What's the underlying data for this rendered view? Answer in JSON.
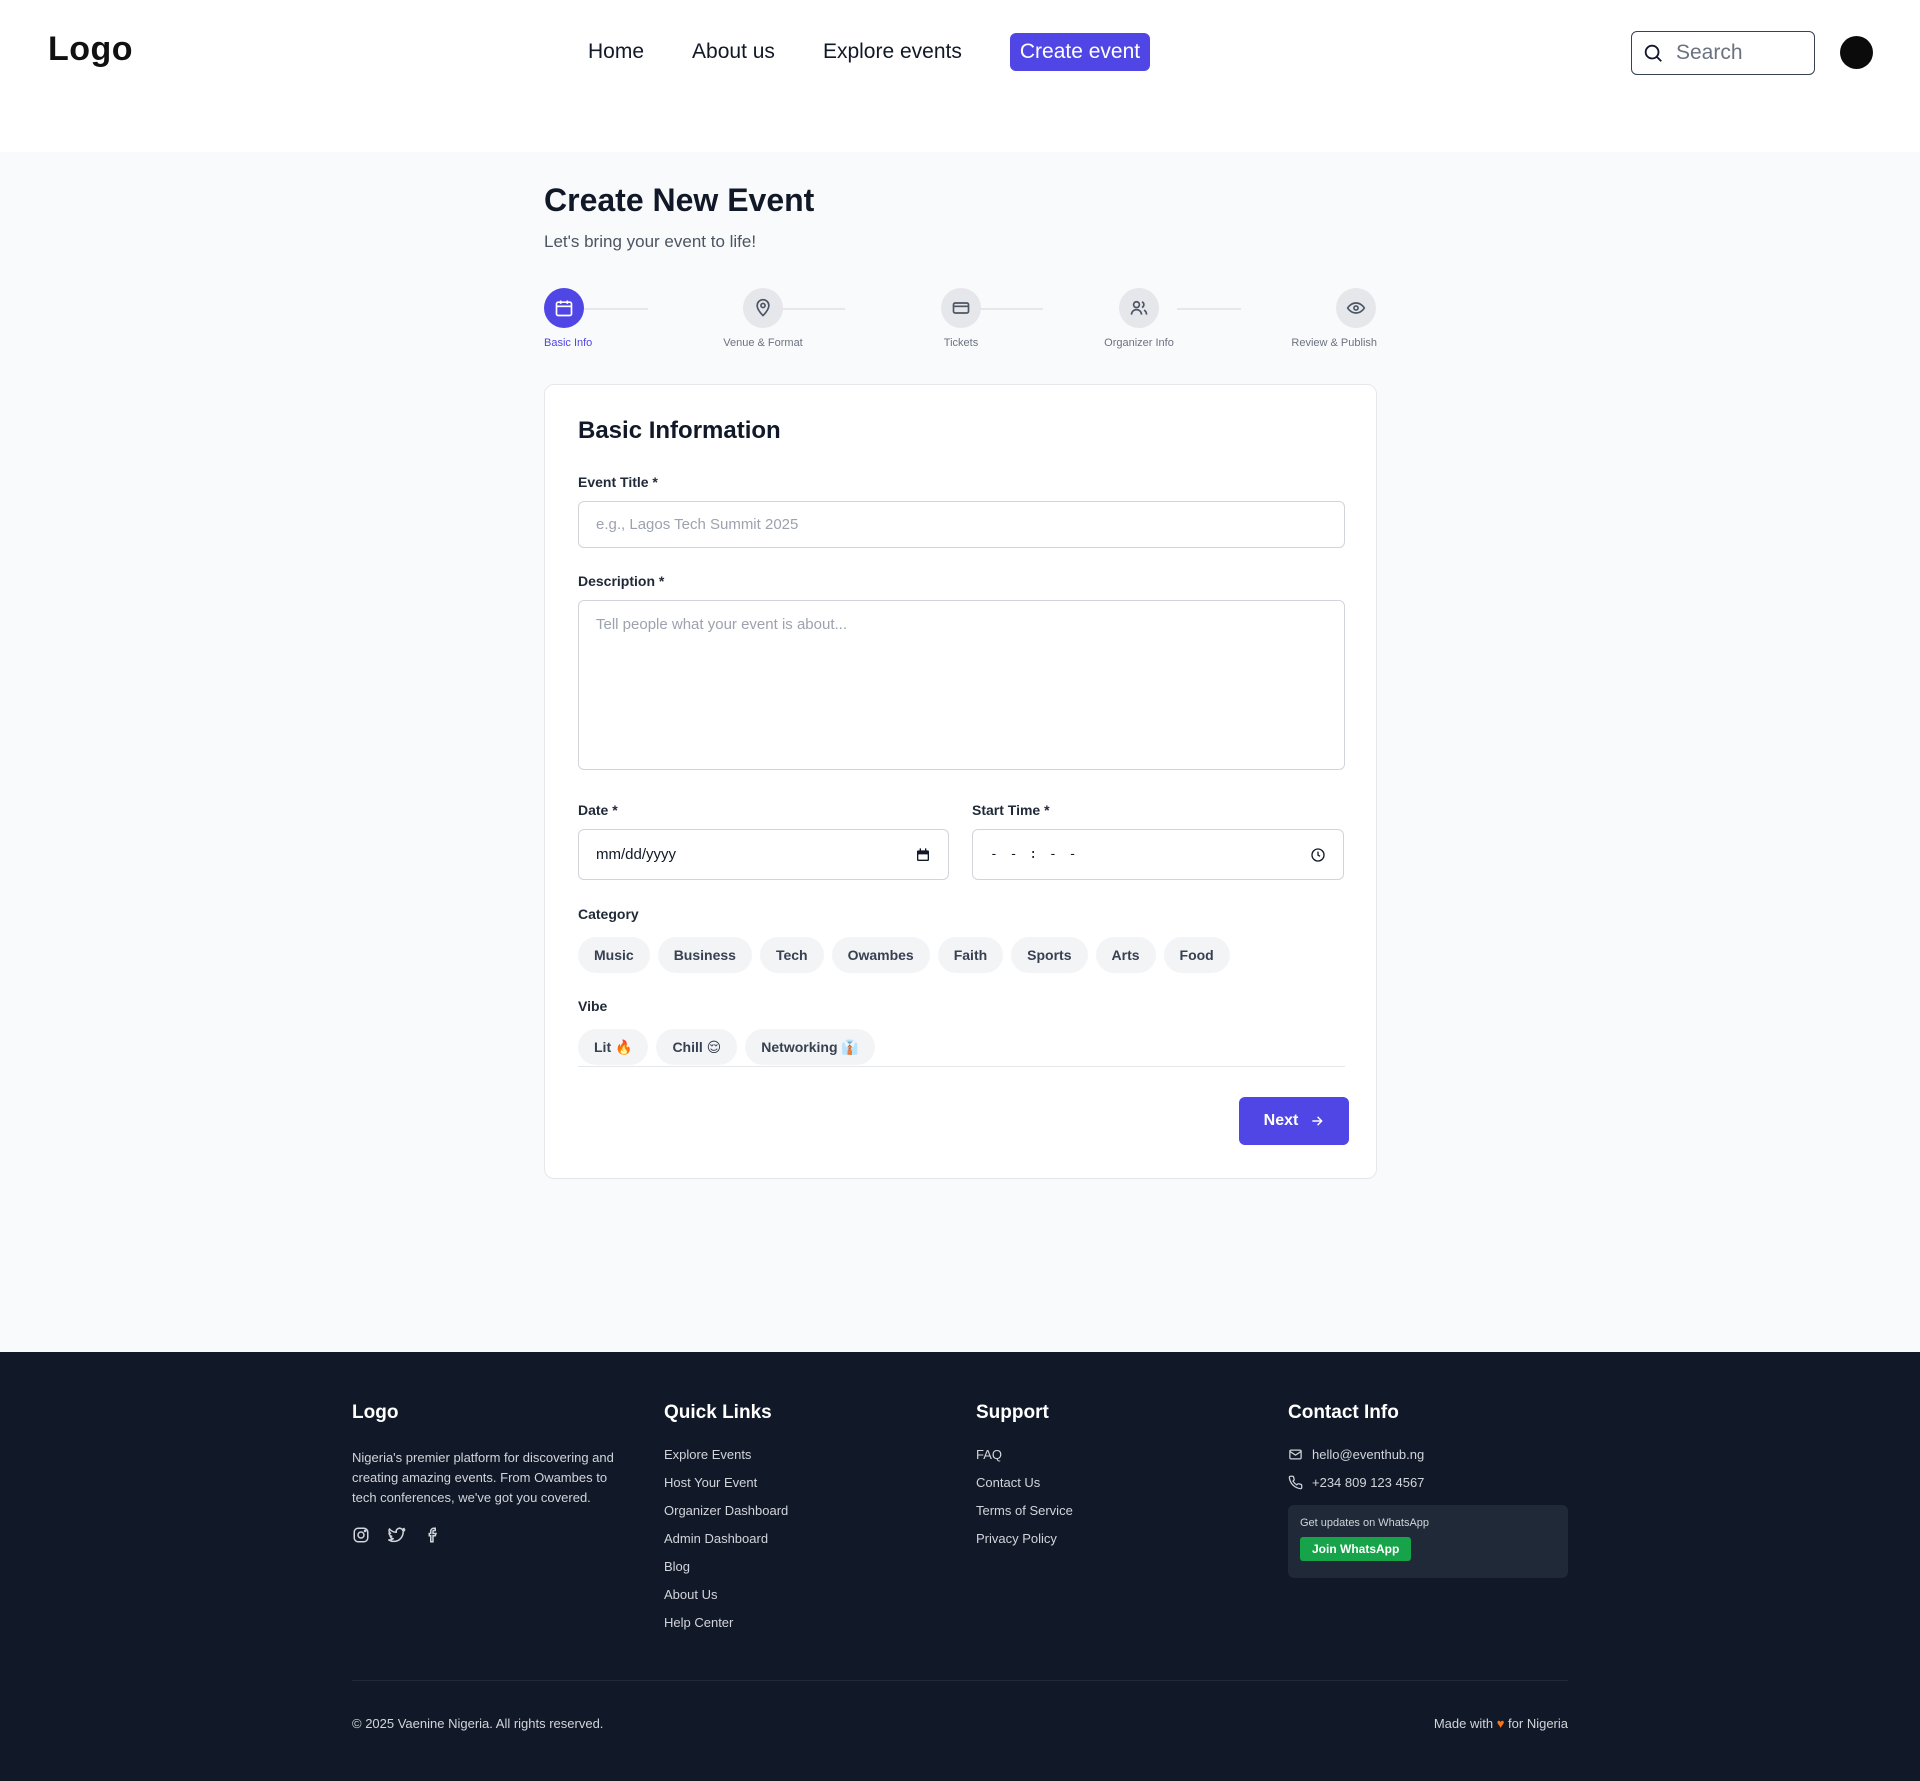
{
  "header": {
    "logo": "Logo",
    "nav": [
      "Home",
      "About us",
      "Explore events"
    ],
    "create_label": "Create event",
    "search_placeholder": "Search"
  },
  "page": {
    "title": "Create New Event",
    "subtitle": "Let's bring your event to life!"
  },
  "steps": [
    {
      "label": "Basic Info",
      "icon": "calendar-icon",
      "active": true
    },
    {
      "label": "Venue & Format",
      "icon": "map-pin-icon",
      "active": false
    },
    {
      "label": "Tickets",
      "icon": "ticket-icon",
      "active": false
    },
    {
      "label": "Organizer Info",
      "icon": "users-icon",
      "active": false
    },
    {
      "label": "Review & Publish",
      "icon": "eye-icon",
      "active": false
    }
  ],
  "form": {
    "title": "Basic Information",
    "event_title_label": "Event Title *",
    "event_title_placeholder": "e.g., Lagos Tech Summit 2025",
    "description_label": "Description *",
    "description_placeholder": "Tell people what your event is about...",
    "date_label": "Date *",
    "date_placeholder": "mm/dd/yyyy",
    "time_label": "Start Time *",
    "time_placeholder": "- - : - -",
    "category_label": "Category",
    "categories": [
      "Music",
      "Business",
      "Tech",
      "Owambes",
      "Faith",
      "Sports",
      "Arts",
      "Food"
    ],
    "vibe_label": "Vibe",
    "vibes": [
      "Lit 🔥",
      "Chill 😌",
      "Networking 👔"
    ],
    "next_label": "Next"
  },
  "footer": {
    "logo": "Logo",
    "description": "Nigeria's premier platform for discovering and creating amazing events. From Owambes to tech conferences, we've got you covered.",
    "quick_links_title": "Quick Links",
    "quick_links": [
      "Explore Events",
      "Host Your Event",
      "Organizer Dashboard",
      "Admin Dashboard",
      "Blog",
      "About Us",
      "Help Center"
    ],
    "support_title": "Support",
    "support_links": [
      "FAQ",
      "Contact Us",
      "Terms of Service",
      "Privacy Policy"
    ],
    "contact_title": "Contact Info",
    "email": "hello@eventhub.ng",
    "phone": "+234 809 123 4567",
    "whatsapp_text": "Get updates on WhatsApp",
    "whatsapp_button": "Join WhatsApp",
    "copyright": "© 2025 Vaenine Nigeria. All rights reserved.",
    "made_with_prefix": "Made with",
    "made_with_suffix": "for Nigeria"
  },
  "colors": {
    "accent": "#4f46e5",
    "footer_bg": "#111827",
    "whatsapp": "#16a34a"
  }
}
